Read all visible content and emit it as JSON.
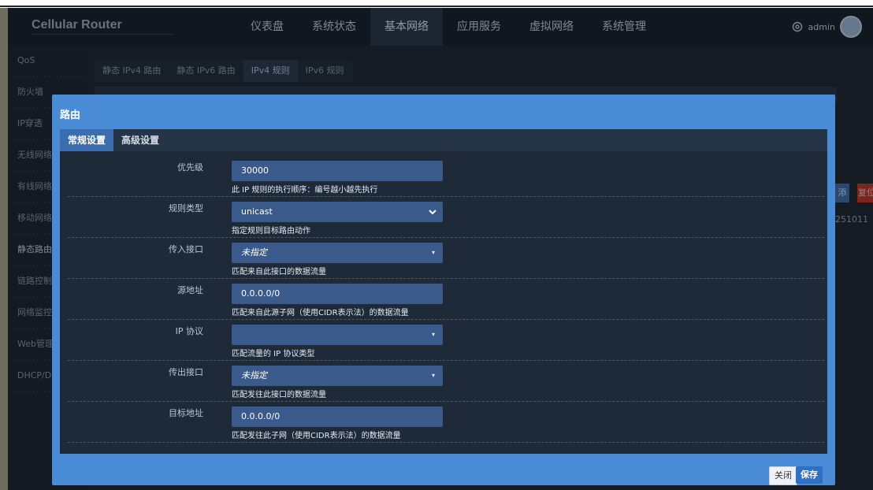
{
  "header": {
    "brand": "Cellular Router",
    "nav": [
      "仪表盘",
      "系统状态",
      "基本网络",
      "应用服务",
      "虚拟网络",
      "系统管理"
    ],
    "active_nav": 2,
    "user": "admin"
  },
  "sidebar": {
    "items": [
      "QoS",
      "防火墙",
      "IP穿透",
      "无线网络",
      "有线网络",
      "移动网络",
      "静态路由",
      "链路控制",
      "网络监控",
      "Web管理",
      "DHCP/DN"
    ],
    "active": 6
  },
  "background": {
    "tabs": [
      "静态 IPv4 路由",
      "静态 IPv6 路由",
      "IPv4 规则",
      "IPv6 规则"
    ],
    "active_tab": 2,
    "red_button": "复位",
    "blue_button": "添",
    "number_fragment": "251011"
  },
  "modal": {
    "title": "路由",
    "tabs": [
      "常规设置",
      "高级设置"
    ],
    "active_tab": 0,
    "fields": [
      {
        "label": "优先级",
        "value": "30000",
        "help": "此 IP 规则的执行顺序：编号越小越先执行",
        "kind": "input"
      },
      {
        "label": "规则类型",
        "value": "unicast",
        "help": "指定规则目标路由动作",
        "kind": "dropdown"
      },
      {
        "label": "传入接口",
        "value": "未指定",
        "help": "匹配来自此接口的数据流量",
        "kind": "select"
      },
      {
        "label": "源地址",
        "value": "0.0.0.0/0",
        "help": "匹配来自此源子网（使用CIDR表示法）的数据流量",
        "kind": "input"
      },
      {
        "label": "IP 协议",
        "value": "",
        "help": "匹配流量的 IP 协议类型",
        "kind": "select"
      },
      {
        "label": "传出接口",
        "value": "未指定",
        "help": "匹配发往此接口的数据流量",
        "kind": "select"
      },
      {
        "label": "目标地址",
        "value": "0.0.0.0/0",
        "help": "匹配发往此子网（使用CIDR表示法）的数据流量",
        "kind": "input"
      }
    ],
    "close_label": "关闭",
    "save_label": "保存"
  }
}
